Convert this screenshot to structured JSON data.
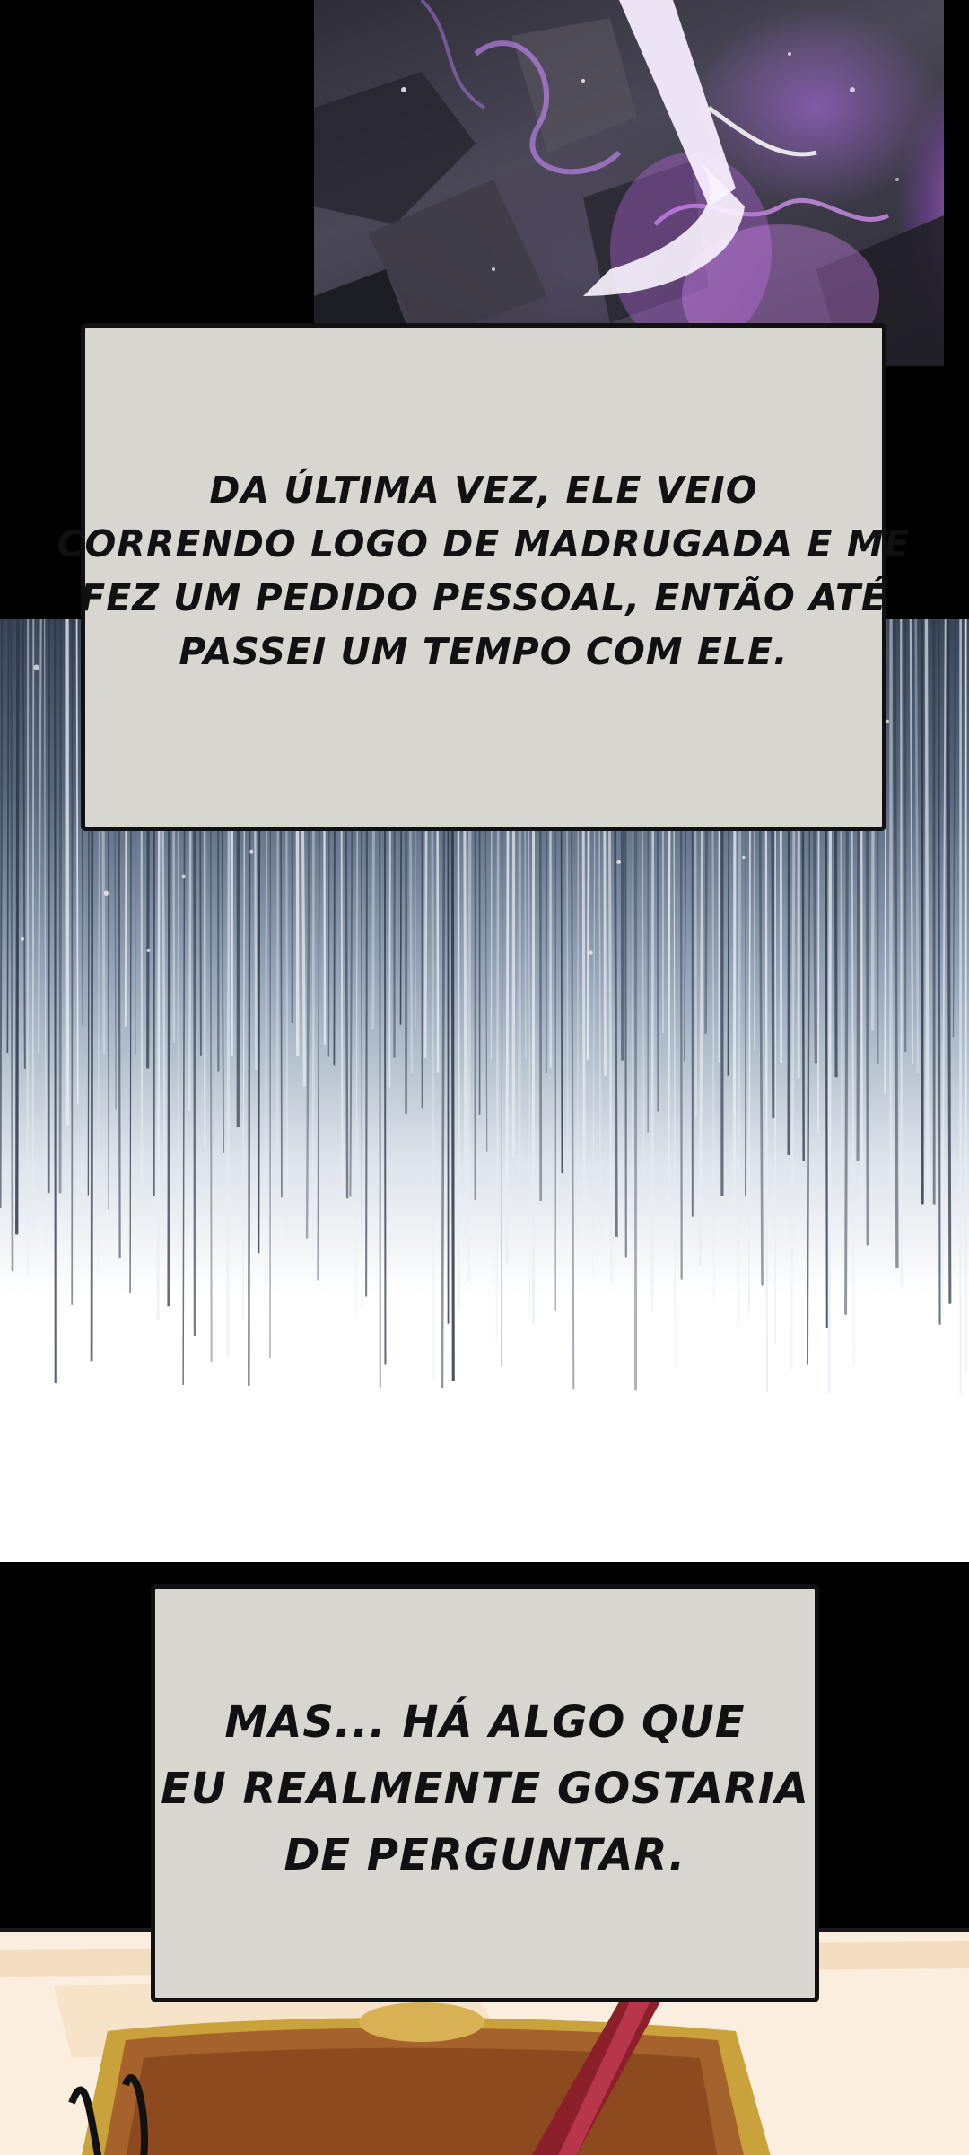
{
  "captions": [
    {
      "lines": [
        "DA ÚLTIMA VEZ, ELE VEIO",
        "CORRENDO LOGO DE MADRUGADA E ME",
        "FEZ UM PEDIDO PESSOAL, ENTÃO ATÉ",
        "PASSEI UM TEMPO COM ELE."
      ]
    },
    {
      "lines": [
        "MAS... HÁ ALGO QUE",
        "EU REALMENTE GOSTARIA",
        "DE PERGUNTAR."
      ]
    }
  ],
  "colors": {
    "caption_background": "#d8d6d0",
    "caption_border": "#111111",
    "energy_purple": "#d27cff",
    "speed_lines": "#3a4658"
  },
  "icons": [
    "purple-energy-art",
    "speed-lines-art",
    "wooden-table-art"
  ]
}
